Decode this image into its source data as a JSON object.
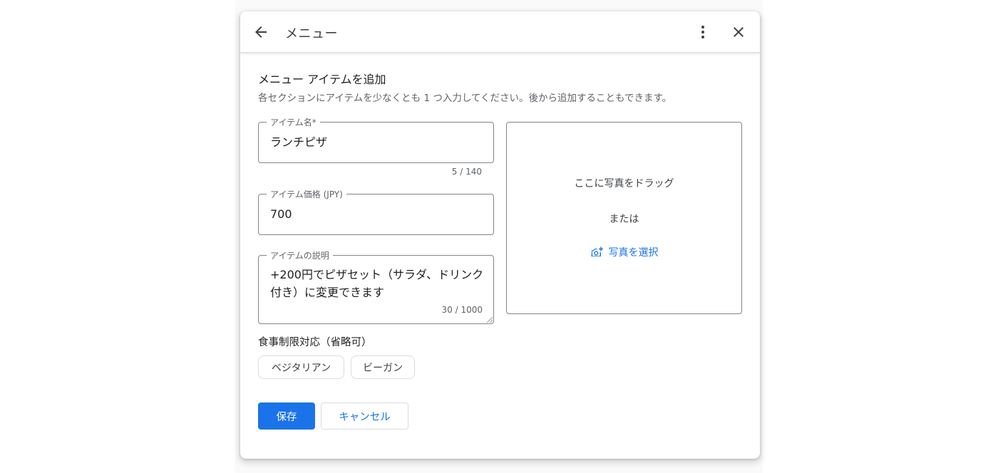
{
  "header": {
    "title": "メニュー",
    "icons": {
      "back": "arrow-back-icon",
      "more": "more-vert-icon",
      "close": "close-icon"
    }
  },
  "section": {
    "title": "メニュー アイテムを追加",
    "subtitle": "各セクションにアイテムを少なくとも 1 つ入力してください。後から追加することもできます。"
  },
  "form": {
    "item_name": {
      "label": "アイテム名*",
      "value": "ランチピザ",
      "counter": "5 / 140"
    },
    "item_price": {
      "label": "アイテム価格 (JPY)",
      "value": "700"
    },
    "item_description": {
      "label": "アイテムの説明",
      "value": "+200円でピザセット（サラダ、ドリンク付き）に変更できます",
      "counter": "30 / 1000"
    }
  },
  "dietary": {
    "label": "食事制限対応（省略可）",
    "chips": [
      "ベジタリアン",
      "ビーガン"
    ]
  },
  "photo": {
    "drag_text": "ここに写真をドラッグ",
    "or_text": "または",
    "select_label": "写真を選択",
    "icon": "add-photo-icon"
  },
  "actions": {
    "save": "保存",
    "cancel": "キャンセル"
  },
  "colors": {
    "primary": "#1a73e8",
    "border": "#80868b",
    "text": "#202124"
  }
}
